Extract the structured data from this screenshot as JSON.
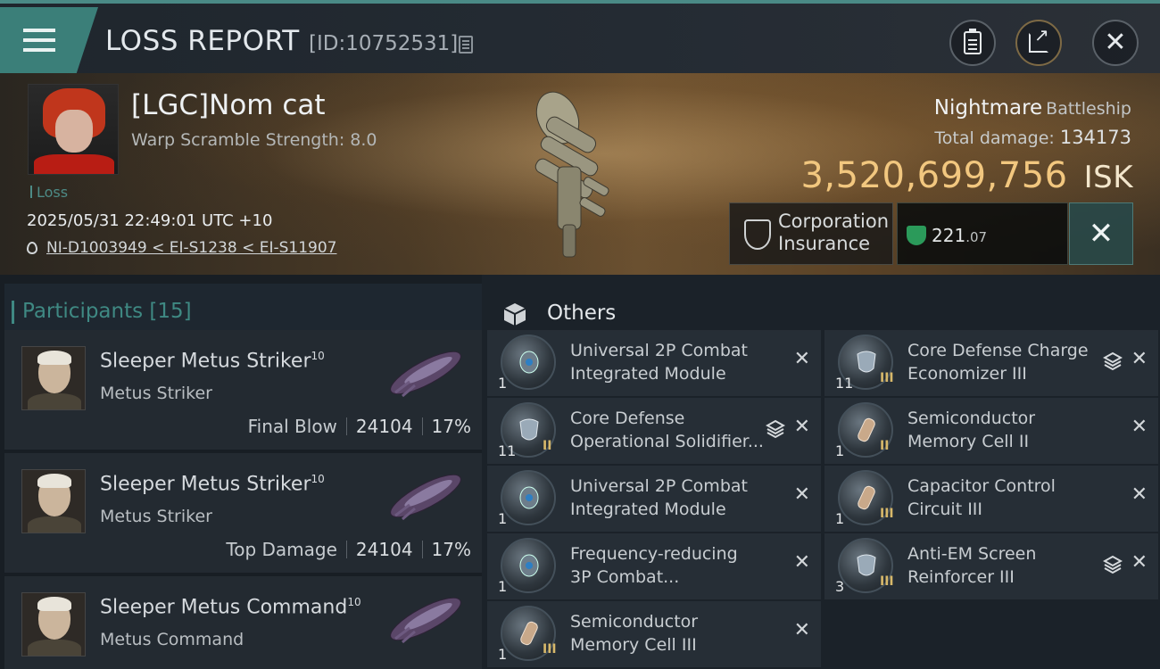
{
  "header": {
    "title": "LOSS REPORT",
    "report_id": "[ID:10752531]"
  },
  "victim": {
    "pilot": "[LGC]Nom cat",
    "warp_scramble": "Warp Scramble Strength: 8.0",
    "loss_label": "Loss",
    "datetime": "2025/05/31 22:49:01 UTC +10",
    "location": "NI-D1003949 < EI-S1238 < EI-S11907",
    "ship_name": "Nightmare",
    "ship_class": "Battleship",
    "total_damage_label": "Total damage:",
    "total_damage": "134173",
    "isk_value": "3,520,699,756",
    "isk_unit": "ISK",
    "insurance_line1": "Corporation",
    "insurance_line2": "Insurance",
    "price_int": "221",
    "price_dec": ".07"
  },
  "participants": {
    "label": "Participants",
    "count": "[15]",
    "rows": [
      {
        "name": "Sleeper Metus Striker",
        "level": "10",
        "ship": "Metus Striker",
        "role": "Final Blow",
        "damage": "24104",
        "percent": "17%"
      },
      {
        "name": "Sleeper Metus Striker",
        "level": "10",
        "ship": "Metus Striker",
        "role": "Top Damage",
        "damage": "24104",
        "percent": "17%"
      },
      {
        "name": "Sleeper Metus Command",
        "level": "10",
        "ship": "Metus Command",
        "role": "",
        "damage": "",
        "percent": ""
      }
    ]
  },
  "others": {
    "label": "Others",
    "left": [
      {
        "line1": "Universal 2P Combat",
        "line2": "Integrated Module",
        "qty": "1",
        "tier": "",
        "stack": false,
        "icon": "combat-module-icon"
      },
      {
        "line1": "Core Defense",
        "line2": "Operational Solidifier...",
        "qty": "11",
        "tier": "II",
        "stack": true,
        "icon": "shield-module-icon"
      },
      {
        "line1": "Universal 2P Combat",
        "line2": "Integrated Module",
        "qty": "1",
        "tier": "",
        "stack": false,
        "icon": "combat-module-icon"
      },
      {
        "line1": "Frequency-reducing",
        "line2": "3P Combat...",
        "qty": "1",
        "tier": "",
        "stack": false,
        "icon": "combat-module-icon"
      },
      {
        "line1": "Semiconductor",
        "line2": "Memory Cell III",
        "qty": "1",
        "tier": "III",
        "stack": false,
        "icon": "capacitor-cell-icon"
      }
    ],
    "right": [
      {
        "line1": "Core Defense Charge",
        "line2": "Economizer III",
        "qty": "11",
        "tier": "III",
        "stack": true,
        "icon": "shield-module-icon"
      },
      {
        "line1": "Semiconductor",
        "line2": "Memory Cell II",
        "qty": "1",
        "tier": "II",
        "stack": false,
        "icon": "capacitor-cell-icon"
      },
      {
        "line1": "Capacitor Control",
        "line2": "Circuit III",
        "qty": "1",
        "tier": "III",
        "stack": false,
        "icon": "capacitor-cell-icon"
      },
      {
        "line1": "Anti-EM Screen",
        "line2": "Reinforcer III",
        "qty": "3",
        "tier": "III",
        "stack": true,
        "icon": "shield-module-icon"
      }
    ]
  },
  "colors": {
    "accent_teal": "#3f8983",
    "isk_gold": "#f2c77f",
    "plex_green": "#2b9a5a"
  }
}
